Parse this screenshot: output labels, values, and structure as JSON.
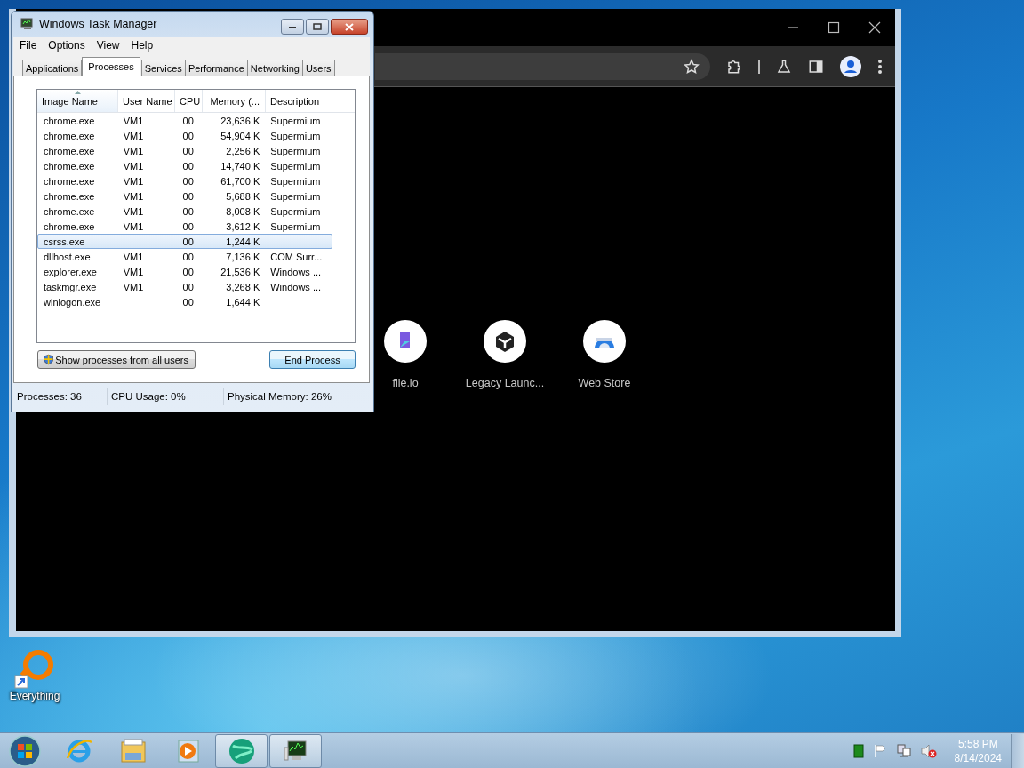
{
  "task_manager": {
    "title": "Windows Task Manager",
    "menu": [
      "File",
      "Options",
      "View",
      "Help"
    ],
    "tabs": [
      {
        "label": "Applications",
        "selected": false
      },
      {
        "label": "Processes",
        "selected": true
      },
      {
        "label": "Services",
        "selected": false
      },
      {
        "label": "Performance",
        "selected": false
      },
      {
        "label": "Networking",
        "selected": false
      },
      {
        "label": "Users",
        "selected": false
      }
    ],
    "columns": [
      "Image Name",
      "User Name",
      "CPU",
      "Memory (...",
      "Description"
    ],
    "rows": [
      {
        "image_name": "chrome.exe",
        "user_name": "VM1",
        "cpu": "00",
        "memory": "23,636 K",
        "description": "Supermium",
        "selected": false
      },
      {
        "image_name": "chrome.exe",
        "user_name": "VM1",
        "cpu": "00",
        "memory": "54,904 K",
        "description": "Supermium",
        "selected": false
      },
      {
        "image_name": "chrome.exe",
        "user_name": "VM1",
        "cpu": "00",
        "memory": "2,256 K",
        "description": "Supermium",
        "selected": false
      },
      {
        "image_name": "chrome.exe",
        "user_name": "VM1",
        "cpu": "00",
        "memory": "14,740 K",
        "description": "Supermium",
        "selected": false
      },
      {
        "image_name": "chrome.exe",
        "user_name": "VM1",
        "cpu": "00",
        "memory": "61,700 K",
        "description": "Supermium",
        "selected": false
      },
      {
        "image_name": "chrome.exe",
        "user_name": "VM1",
        "cpu": "00",
        "memory": "5,688 K",
        "description": "Supermium",
        "selected": false
      },
      {
        "image_name": "chrome.exe",
        "user_name": "VM1",
        "cpu": "00",
        "memory": "8,008 K",
        "description": "Supermium",
        "selected": false
      },
      {
        "image_name": "chrome.exe",
        "user_name": "VM1",
        "cpu": "00",
        "memory": "3,612 K",
        "description": "Supermium",
        "selected": false
      },
      {
        "image_name": "csrss.exe",
        "cpu": "00",
        "memory": "1,244 K",
        "selected": true
      },
      {
        "image_name": "dllhost.exe",
        "user_name": "VM1",
        "cpu": "00",
        "memory": "7,136 K",
        "description": "COM Surr...",
        "selected": false
      },
      {
        "image_name": "explorer.exe",
        "user_name": "VM1",
        "cpu": "00",
        "memory": "21,536 K",
        "description": "Windows ...",
        "selected": false
      },
      {
        "image_name": "taskmgr.exe",
        "user_name": "VM1",
        "cpu": "00",
        "memory": "3,268 K",
        "description": "Windows ...",
        "selected": false
      },
      {
        "image_name": "winlogon.exe",
        "cpu": "00",
        "memory": "1,644 K",
        "selected": false
      }
    ],
    "show_all_button": "Show processes from all users",
    "end_button": "End Process",
    "status_bar": [
      "Processes: 36",
      "CPU Usage: 0%",
      "Physical Memory: 26%"
    ]
  },
  "browser": {
    "shortcuts": [
      "file.io",
      "Legacy Launc...",
      "Web Store"
    ]
  },
  "desktop_icons": [
    "Everything"
  ],
  "taskbar": {
    "buttons": [
      {
        "open": false
      },
      {
        "open": false
      },
      {
        "open": false
      },
      {
        "open": true
      },
      {
        "open": true
      }
    ],
    "time": "5:58 PM",
    "date": "8/14/2024"
  }
}
